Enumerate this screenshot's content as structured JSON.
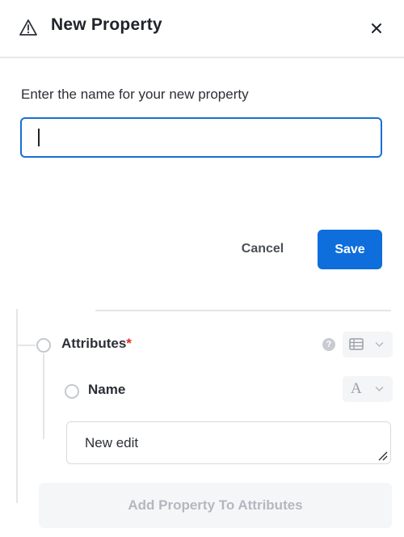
{
  "modal": {
    "title": "New Property",
    "close_icon": "close-icon",
    "warning_icon": "warning-triangle-icon"
  },
  "form": {
    "prompt": "Enter the name for your new property",
    "name_value": "",
    "cancel_label": "Cancel",
    "save_label": "Save"
  },
  "tree": {
    "attributes": {
      "label": "Attributes",
      "required_marker": "*",
      "help_icon_glyph": "?",
      "type_icon": "table-icon"
    },
    "name_property": {
      "label": "Name",
      "type_glyph": "A",
      "value": "New edit"
    },
    "add_property_label": "Add Property To Attributes"
  },
  "colors": {
    "accent": "#0e6edc",
    "focus_border": "#1a6fd6",
    "required": "#d93025",
    "muted": "#b4b8be"
  }
}
